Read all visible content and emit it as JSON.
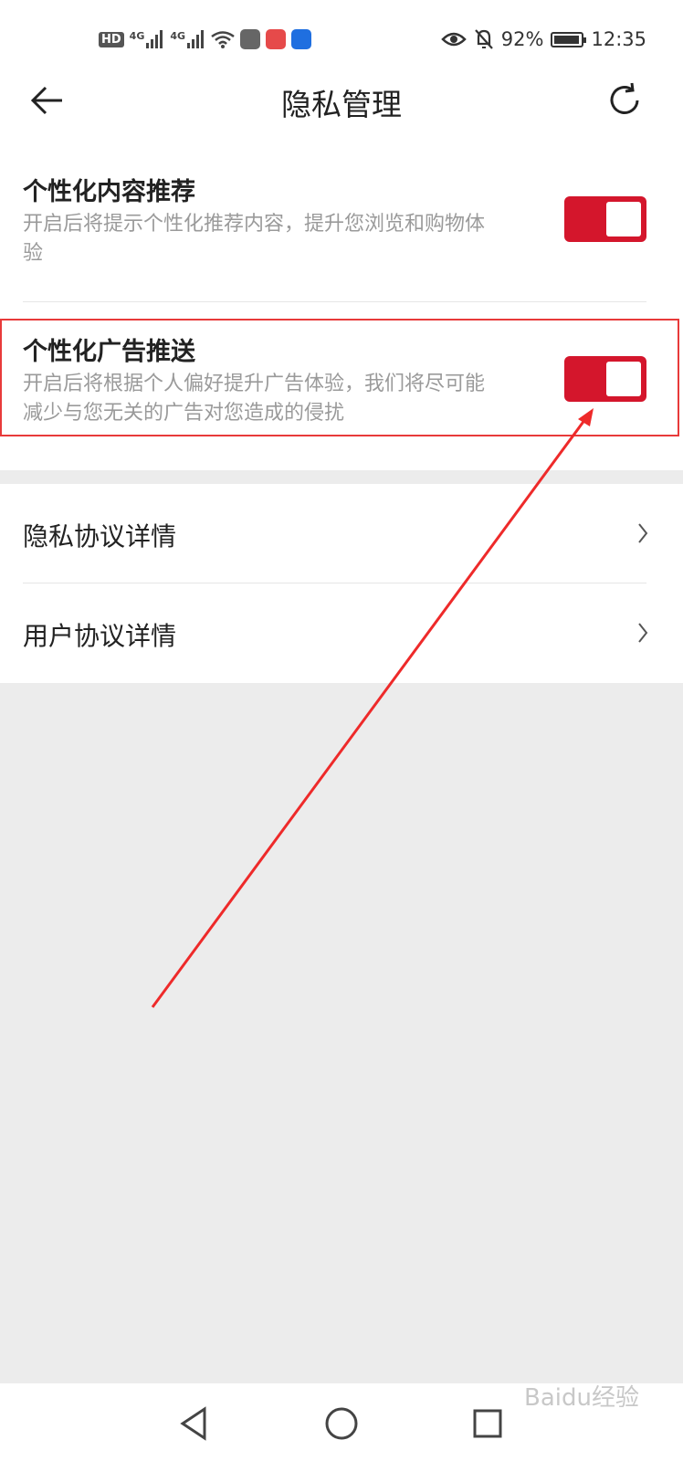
{
  "status_bar": {
    "hd_label": "HD",
    "signal1_label": "4G",
    "signal2_label": "4G",
    "battery_percent": "92%",
    "time": "12:35",
    "icons": [
      "hd-icon",
      "signal-icon",
      "signal-icon",
      "wifi-icon",
      "huawei-app-icon",
      "book-app-icon",
      "bulb-app-icon",
      "eye-icon",
      "mute-bell-icon",
      "battery-icon"
    ]
  },
  "header": {
    "title": "隐私管理",
    "back_icon": "arrow-left-icon",
    "refresh_icon": "refresh-icon"
  },
  "settings": [
    {
      "title": "个性化内容推荐",
      "desc": "开启后将提示个性化推荐内容，提升您浏览和购物体验",
      "enabled": true
    },
    {
      "title": "个性化广告推送",
      "desc": "开启后将根据个人偏好提升广告体验，我们将尽可能减少与您无关的广告对您造成的侵扰",
      "enabled": true
    }
  ],
  "links": [
    {
      "label": "隐私协议详情"
    },
    {
      "label": "用户协议详情"
    }
  ],
  "nav": {
    "icons": [
      "back-triangle-icon",
      "home-circle-icon",
      "recents-square-icon"
    ]
  },
  "watermark": "Baidu经验",
  "colors": {
    "accent": "#d4162c",
    "highlight_border": "#e83a3a",
    "annotation_arrow": "#ee2a2a",
    "page_bg": "#ececec"
  }
}
